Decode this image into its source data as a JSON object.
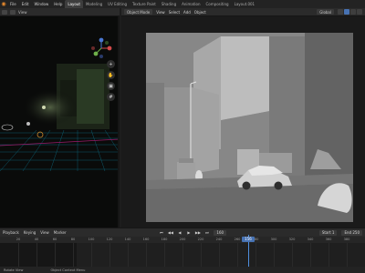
{
  "menubar": {
    "logo_glyph": "◉",
    "items": [
      "File",
      "Edit",
      "Window",
      "Help"
    ],
    "workspaces": [
      "Layout",
      "Modeling",
      "UV Editing",
      "Texture Paint",
      "Shading",
      "Animation",
      "Compositing",
      "Layout.001"
    ],
    "active_workspace_index": 0
  },
  "left_viewport": {
    "header_label": "View"
  },
  "right_viewport": {
    "mode_label": "Object Mode",
    "menus": [
      "View",
      "Select",
      "Add",
      "Object"
    ],
    "transform_label": "Global",
    "camera_bg": "#888888"
  },
  "timeline": {
    "menus": [
      "Playback",
      "Keying",
      "View",
      "Marker"
    ],
    "controls": [
      "⏮",
      "◀◀",
      "◀",
      "▶",
      "▶▶",
      "⏭"
    ],
    "current_frame": "160",
    "start_label": "Start",
    "start_value": "1",
    "end_label": "End",
    "end_value": "250",
    "ruler_ticks": [
      "20",
      "40",
      "60",
      "80",
      "100",
      "120",
      "140",
      "160",
      "180",
      "200",
      "220",
      "240",
      "260",
      "280",
      "300",
      "320",
      "340",
      "360",
      "380"
    ],
    "playhead_label": "156"
  },
  "statusbar": {
    "items": [
      "Rotate View",
      "Object Context Menu"
    ]
  },
  "colors": {
    "accent": "#4772b3",
    "playhead": "#4f8fde",
    "grid_cyan": "#0d6f86",
    "grid_magenta": "#9b1b6a"
  }
}
